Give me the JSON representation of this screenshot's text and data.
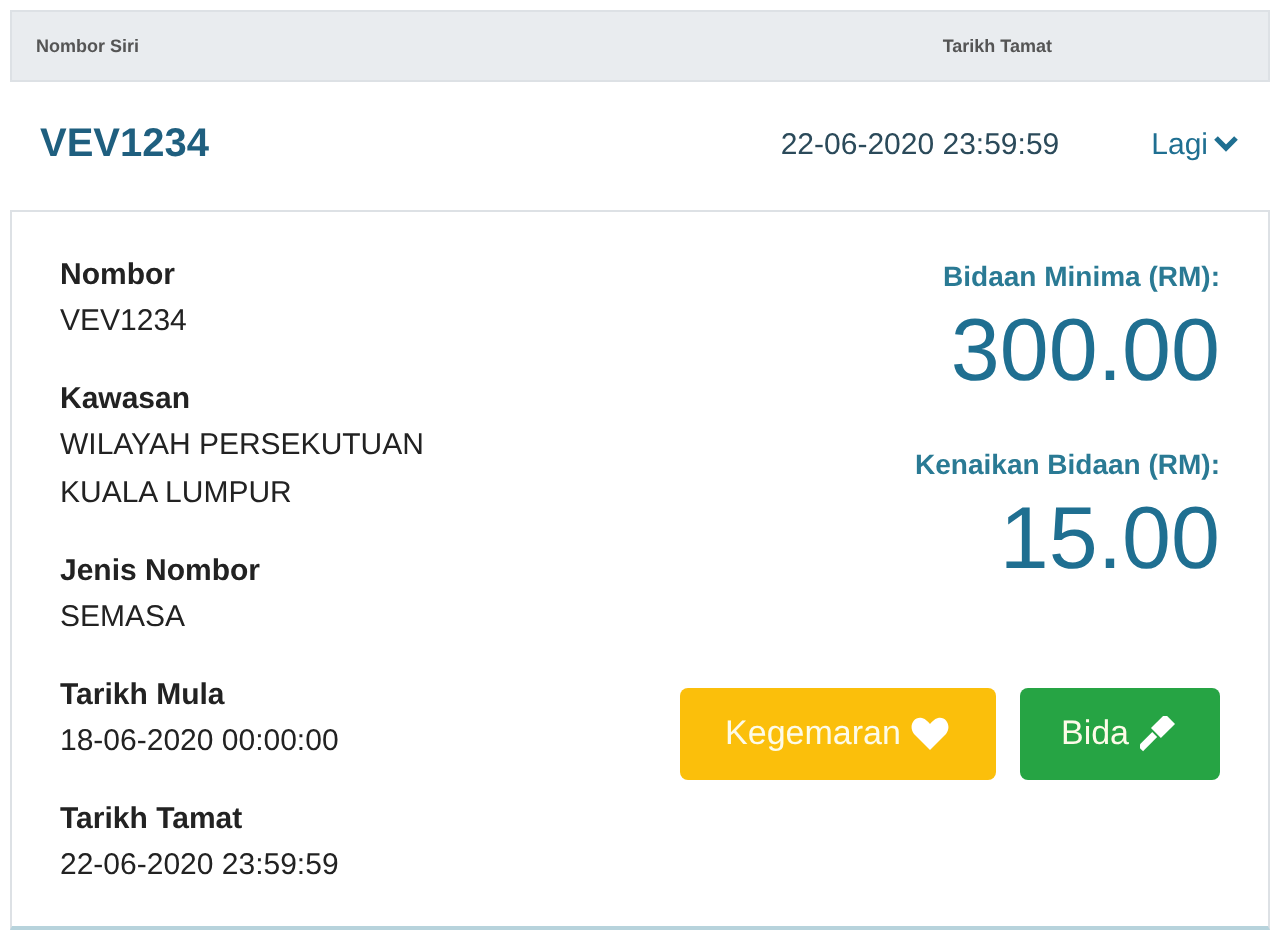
{
  "table_header": {
    "columns": [
      "Nombor Siri",
      "Tarikh Tamat"
    ]
  },
  "row": {
    "serial": "VEV1234",
    "end_date": "22-06-2020 23:59:59",
    "more_link": "Lagi"
  },
  "details": [
    {
      "label": "Nombor",
      "value_lines": [
        "VEV1234"
      ]
    },
    {
      "label": "Kawasan",
      "value_lines": [
        "WILAYAH PERSEKUTUAN",
        "KUALA LUMPUR"
      ]
    },
    {
      "label": "Jenis Nombor",
      "value_lines": [
        "SEMASA"
      ]
    },
    {
      "label": "Tarikh Mula",
      "value_lines": [
        "18-06-2020 00:00:00"
      ]
    },
    {
      "label": "Tarikh Tamat",
      "value_lines": [
        "22-06-2020 23:59:59"
      ]
    }
  ],
  "amounts": [
    {
      "label": "Bidaan Minima (RM):",
      "value": "300.00"
    },
    {
      "label": "Kenaikan Bidaan (RM):",
      "value": "15.00"
    }
  ],
  "buttons": [
    {
      "kind": "favourite",
      "label": "Kegemaran"
    },
    {
      "kind": "bid",
      "label": "Bida"
    }
  ]
}
